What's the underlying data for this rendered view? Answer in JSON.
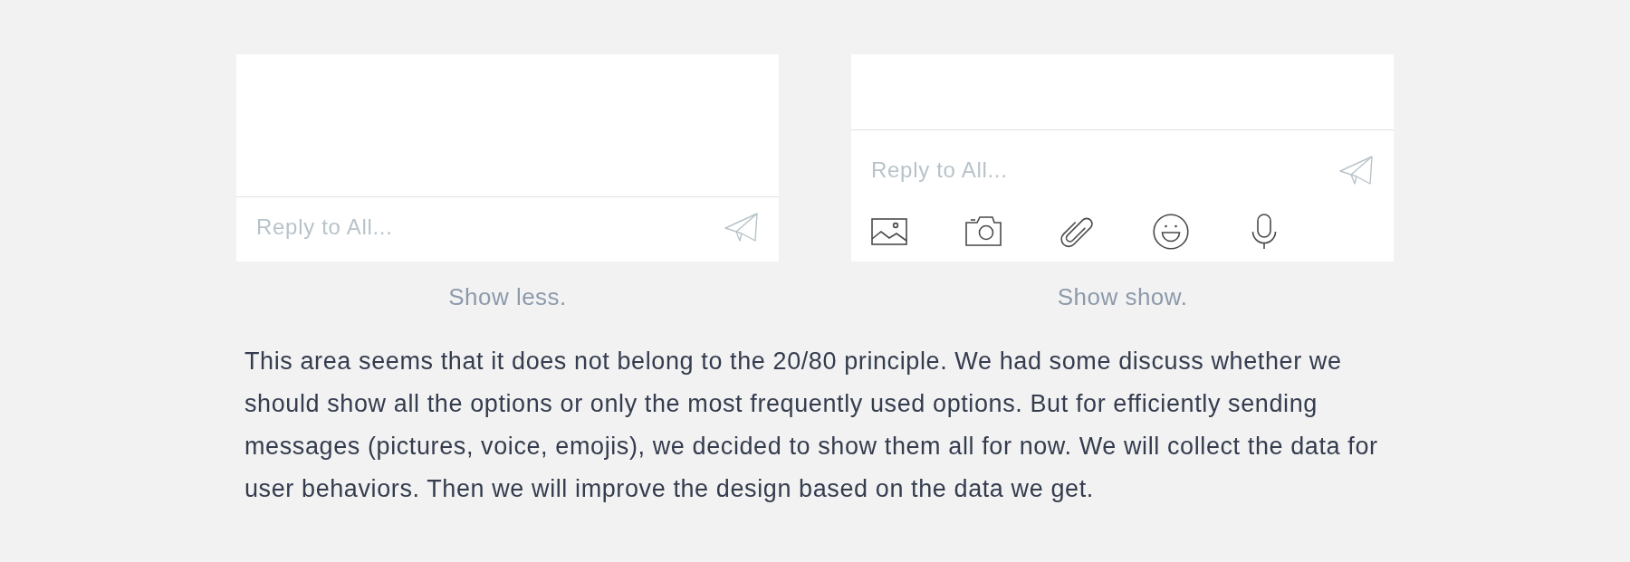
{
  "composers": [
    {
      "expanded": false,
      "input": {
        "placeholder": "Reply to All..."
      },
      "caption": "Show less."
    },
    {
      "expanded": true,
      "input": {
        "placeholder": "Reply to All..."
      },
      "tools": [
        {
          "kind": "image"
        },
        {
          "kind": "camera"
        },
        {
          "kind": "attachment"
        },
        {
          "kind": "emoji"
        },
        {
          "kind": "microphone"
        }
      ],
      "caption": "Show show."
    }
  ],
  "description": "This area seems that it does not belong to the 20/80 principle. We had some discuss whether we should show all the options or only the most frequently used options. But for efficiently sending messages (pictures, voice, emojis), we decided to show them all for now. We will collect the data for user behaviors. Then we will improve the design based on the data we get."
}
